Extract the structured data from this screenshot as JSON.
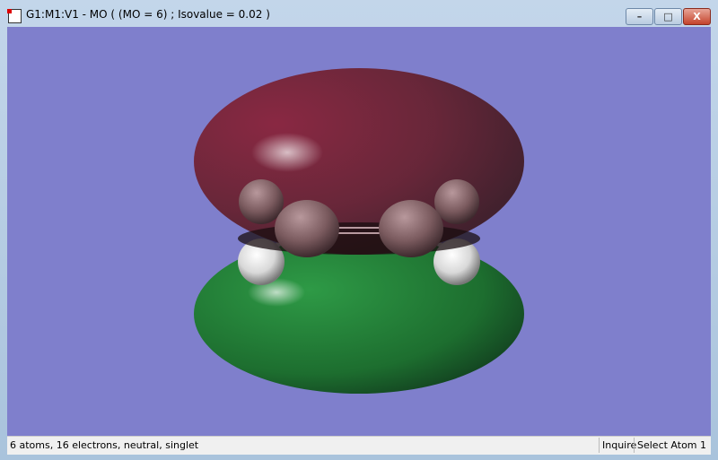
{
  "window": {
    "title": "G1:M1:V1 - MO ( (MO = 6) ; Isovalue = 0.02 )",
    "buttons": {
      "minimize": "–",
      "maximize": "□",
      "close": "X"
    }
  },
  "viewer": {
    "background": "#7f7fcc",
    "positive_lobe_color": "#6e1e30",
    "negative_lobe_color": "#1f7a33"
  },
  "status": {
    "molecule_info": "6 atoms, 16 electrons, neutral, singlet",
    "mode": "Inquire",
    "action": "Select Atom 1"
  }
}
